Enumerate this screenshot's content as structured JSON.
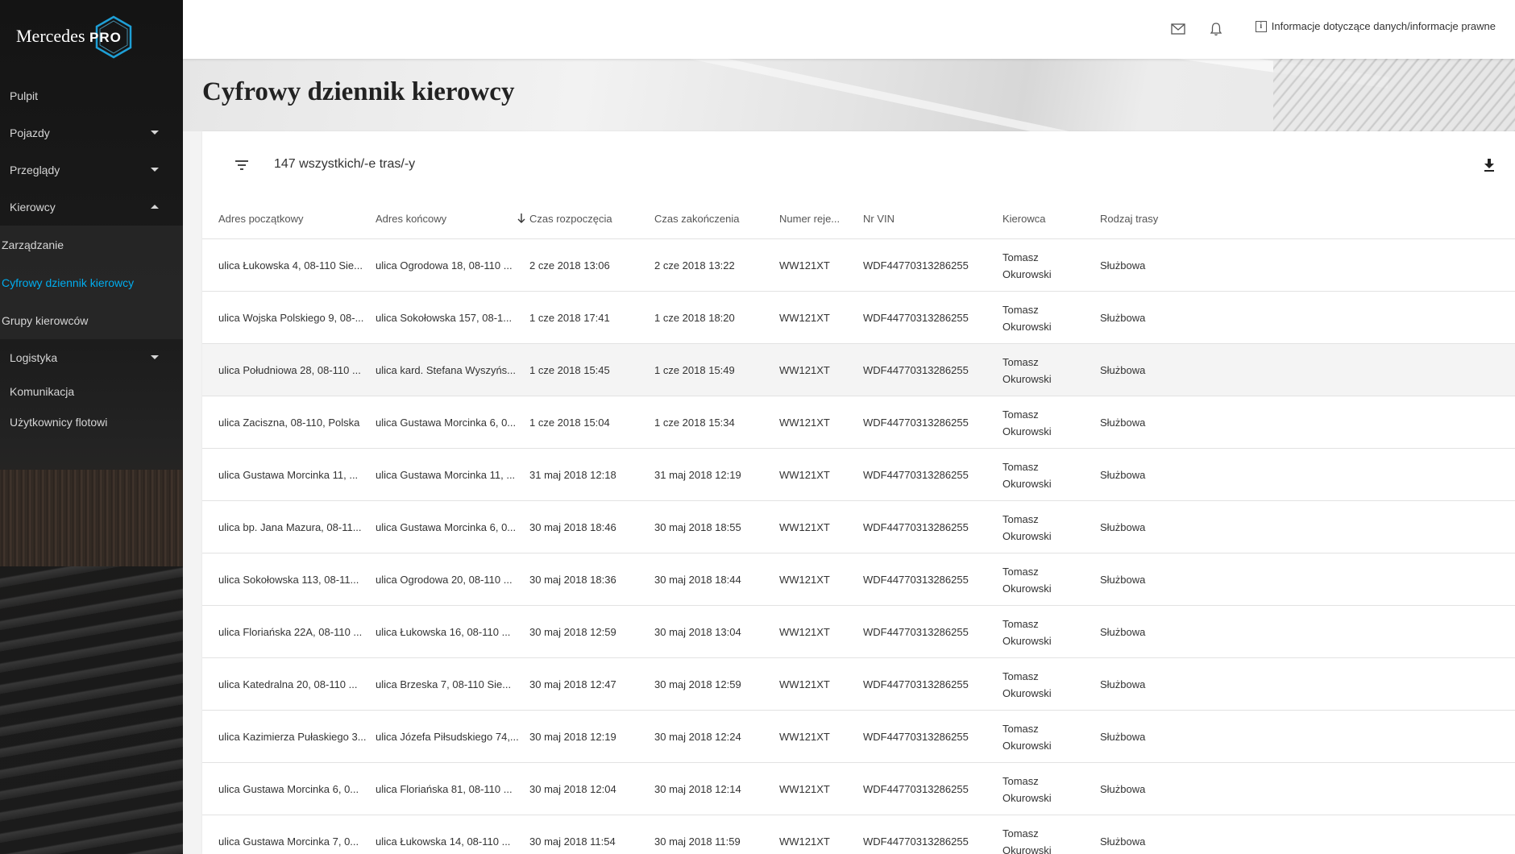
{
  "brand": {
    "name": "Mercedes",
    "pro": "PRO"
  },
  "sidebar": {
    "items": [
      {
        "label": "Pulpit",
        "chevron": "none"
      },
      {
        "label": "Pojazdy",
        "chevron": "down"
      },
      {
        "label": "Przeglądy",
        "chevron": "down"
      },
      {
        "label": "Kierowcy",
        "chevron": "up"
      }
    ],
    "subitems": [
      {
        "label": "Zarządzanie",
        "active": false
      },
      {
        "label": "Cyfrowy dziennik kierowcy",
        "active": true
      },
      {
        "label": "Grupy kierowców",
        "active": false
      }
    ],
    "items_after": [
      {
        "label": "Logistyka",
        "chevron": "down"
      },
      {
        "label": "Komunikacja",
        "chevron": "none"
      },
      {
        "label": "Użytkownicy flotowi",
        "chevron": "none"
      }
    ]
  },
  "topbar": {
    "icons": [
      "mail-icon",
      "bell-icon"
    ],
    "legal_label": "Informacje dotyczące danych/informacje prawne"
  },
  "page": {
    "title": "Cyfrowy dziennik kierowcy"
  },
  "table": {
    "count_label": "147 wszystkich/-e tras/-y",
    "headers": [
      "Adres początkowy",
      "Adres końcowy",
      "Czas rozpoczęcia",
      "Czas zakończenia",
      "Numer reje...",
      "Nr VIN",
      "Kierowca",
      "Rodzaj trasy"
    ],
    "sorted_column": "Czas rozpoczęcia",
    "rows": [
      [
        "ulica Łukowska 4, 08-110 Sie...",
        "ulica Ogrodowa 18, 08-110 ...",
        "2 cze 2018 13:06",
        "2 cze 2018 13:22",
        "WW121XT",
        "WDF44770313286255",
        "Tomasz Okurowski",
        "Służbowa"
      ],
      [
        "ulica Wojska Polskiego 9, 08-...",
        "ulica Sokołowska 157, 08-1...",
        "1 cze 2018 17:41",
        "1 cze 2018 18:20",
        "WW121XT",
        "WDF44770313286255",
        "Tomasz Okurowski",
        "Służbowa"
      ],
      [
        "ulica Południowa 28, 08-110 ...",
        "ulica kard. Stefana Wyszyńs...",
        "1 cze 2018 15:45",
        "1 cze 2018 15:49",
        "WW121XT",
        "WDF44770313286255",
        "Tomasz Okurowski",
        "Służbowa"
      ],
      [
        "ulica Zaciszna, 08-110, Polska",
        "ulica Gustawa Morcinka 6, 0...",
        "1 cze 2018 15:04",
        "1 cze 2018 15:34",
        "WW121XT",
        "WDF44770313286255",
        "Tomasz Okurowski",
        "Służbowa"
      ],
      [
        "ulica Gustawa Morcinka 11, ...",
        "ulica Gustawa Morcinka 11, ...",
        "31 maj 2018 12:18",
        "31 maj 2018 12:19",
        "WW121XT",
        "WDF44770313286255",
        "Tomasz Okurowski",
        "Służbowa"
      ],
      [
        "ulica bp. Jana Mazura, 08-11...",
        "ulica Gustawa Morcinka 6, 0...",
        "30 maj 2018 18:46",
        "30 maj 2018 18:55",
        "WW121XT",
        "WDF44770313286255",
        "Tomasz Okurowski",
        "Służbowa"
      ],
      [
        "ulica Sokołowska 113, 08-11...",
        "ulica Ogrodowa 20, 08-110 ...",
        "30 maj 2018 18:36",
        "30 maj 2018 18:44",
        "WW121XT",
        "WDF44770313286255",
        "Tomasz Okurowski",
        "Służbowa"
      ],
      [
        "ulica Floriańska 22A, 08-110 ...",
        "ulica Łukowska 16, 08-110 ...",
        "30 maj 2018 12:59",
        "30 maj 2018 13:04",
        "WW121XT",
        "WDF44770313286255",
        "Tomasz Okurowski",
        "Służbowa"
      ],
      [
        "ulica Katedralna 20, 08-110 ...",
        "ulica Brzeska 7, 08-110 Sie...",
        "30 maj 2018 12:47",
        "30 maj 2018 12:59",
        "WW121XT",
        "WDF44770313286255",
        "Tomasz Okurowski",
        "Służbowa"
      ],
      [
        "ulica Kazimierza Pułaskiego 3...",
        "ulica Józefa Piłsudskiego 74,...",
        "30 maj 2018 12:19",
        "30 maj 2018 12:24",
        "WW121XT",
        "WDF44770313286255",
        "Tomasz Okurowski",
        "Służbowa"
      ],
      [
        "ulica Gustawa Morcinka 6, 0...",
        "ulica Floriańska 81, 08-110 ...",
        "30 maj 2018 12:04",
        "30 maj 2018 12:14",
        "WW121XT",
        "WDF44770313286255",
        "Tomasz Okurowski",
        "Służbowa"
      ],
      [
        "ulica Gustawa Morcinka 7, 0...",
        "ulica Łukowska 14, 08-110 ...",
        "30 maj 2018 11:54",
        "30 maj 2018 11:59",
        "WW121XT",
        "WDF44770313286255",
        "Tomasz Okurowski",
        "Służbowa"
      ]
    ],
    "highlighted_row": 2
  },
  "colors": {
    "accent": "#00adef",
    "sidebar_bg": "#1c1c1c"
  }
}
